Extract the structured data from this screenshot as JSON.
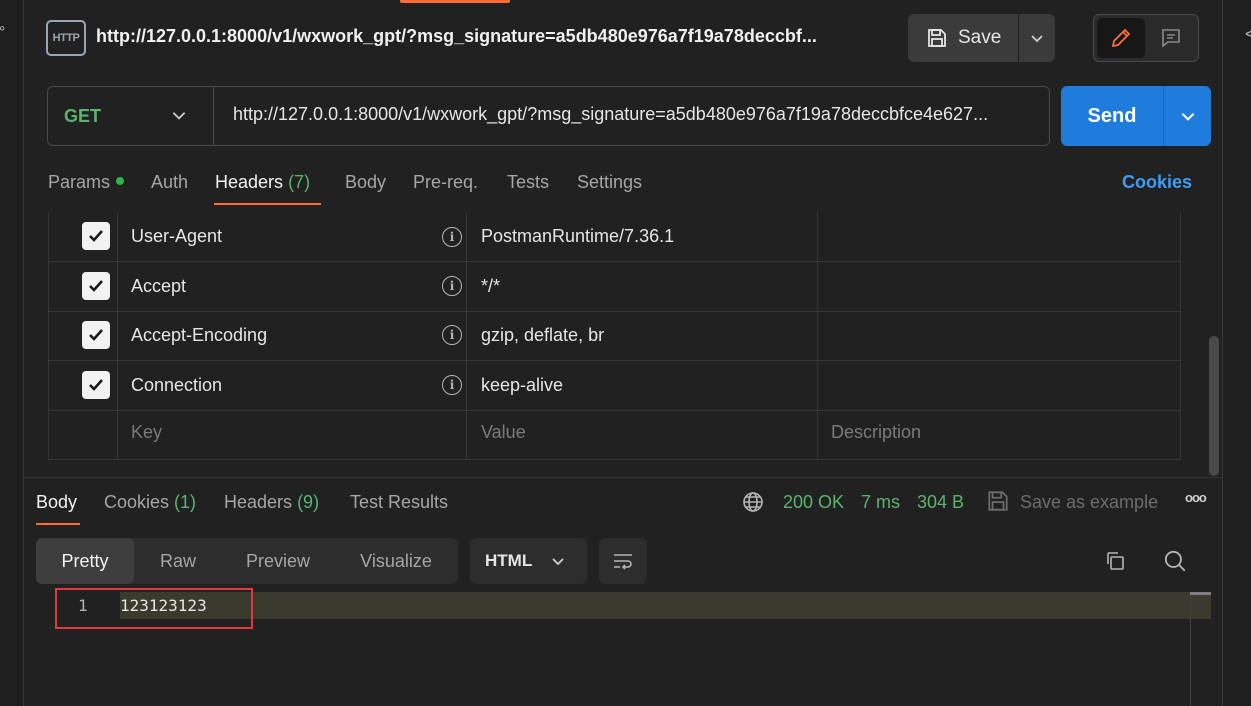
{
  "edges": {
    "left_glyph": "°",
    "right_glyph": "<"
  },
  "title": {
    "icon_text": "HTTP",
    "text": "http://127.0.0.1:8000/v1/wxwork_gpt/?msg_signature=a5db480e976a7f19a78deccbf..."
  },
  "toolbar": {
    "save_label": "Save"
  },
  "request": {
    "method": "GET",
    "url": "http://127.0.0.1:8000/v1/wxwork_gpt/?msg_signature=a5db480e976a7f19a78deccbfce4e627...",
    "send_label": "Send"
  },
  "tabs": {
    "params": "Params",
    "auth": "Auth",
    "headers": "Headers",
    "headers_count": "(7)",
    "body": "Body",
    "prereq": "Pre-req.",
    "tests": "Tests",
    "settings": "Settings",
    "cookies": "Cookies"
  },
  "headers_table": {
    "rows": [
      {
        "key": "User-Agent",
        "value": "PostmanRuntime/7.36.1",
        "checked": true
      },
      {
        "key": "Accept",
        "value": "*/*",
        "checked": true
      },
      {
        "key": "Accept-Encoding",
        "value": "gzip, deflate, br",
        "checked": true
      },
      {
        "key": "Connection",
        "value": "keep-alive",
        "checked": true
      }
    ],
    "placeholder": {
      "key": "Key",
      "value": "Value",
      "description": "Description"
    },
    "info_glyph": "i"
  },
  "response": {
    "tabs": {
      "body": "Body",
      "cookies": "Cookies",
      "cookies_count": "(1)",
      "headers": "Headers",
      "headers_count": "(9)",
      "test_results": "Test Results"
    },
    "status": "200 OK",
    "time": "7 ms",
    "size": "304 B",
    "save_example": "Save as example",
    "more": "ooo",
    "views": {
      "pretty": "Pretty",
      "raw": "Raw",
      "preview": "Preview",
      "visualize": "Visualize"
    },
    "language": "HTML",
    "code": {
      "line_number": "1",
      "text": "123123123"
    }
  },
  "colors": {
    "accent": "#ff6c37",
    "send_blue": "#1f7bdc",
    "method_green": "#5ab46e",
    "link_blue": "#3d9cf5",
    "highlight_red": "#e0393e"
  }
}
